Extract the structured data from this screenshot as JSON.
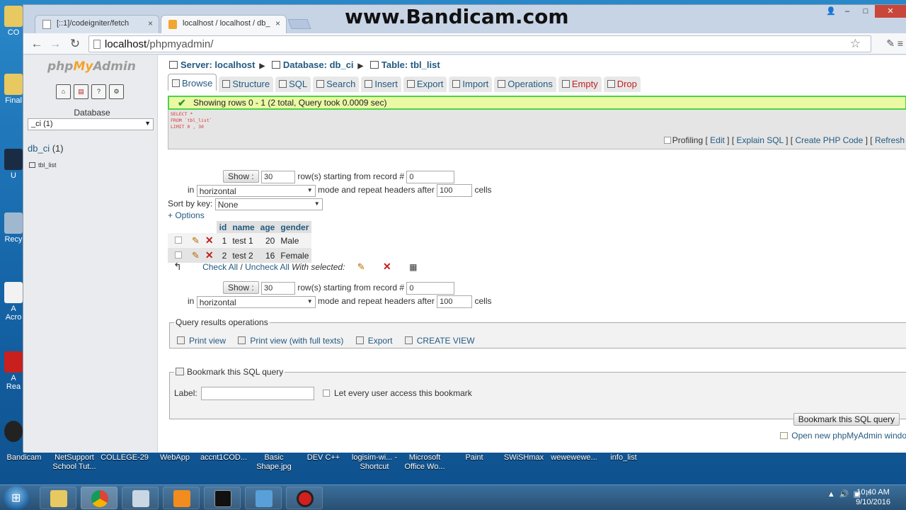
{
  "watermark": "www.Bandicam.com",
  "browser": {
    "tabs": [
      {
        "title": "[::1]/codeigniter/fetch",
        "close": "×"
      },
      {
        "title": "localhost / localhost / db_",
        "close": "×"
      }
    ],
    "url_host": "localhost",
    "url_path": "/phpmyadmin/",
    "nav": {
      "back": "←",
      "forward": "→",
      "reload": "↻",
      "star": "☆"
    },
    "window_controls": {
      "minimize": "–",
      "maximize": "□",
      "close": "✕"
    }
  },
  "sidebar": {
    "logo_php": "php",
    "logo_my": "My",
    "logo_admin": "Admin",
    "database_label": "Database",
    "db_select_value": "_ci (1)",
    "db_link": "db_ci",
    "db_count": " (1)",
    "table_item": "tbl_list",
    "icons": [
      "home-icon",
      "sql-icon",
      "docs-icon",
      "settings-icon"
    ]
  },
  "breadcrumb": {
    "server": "Server: localhost",
    "database": "Database: db_ci",
    "table": "Table: tbl_list",
    "sep": "▶"
  },
  "tabs": [
    "Browse",
    "Structure",
    "SQL",
    "Search",
    "Insert",
    "Export",
    "Import",
    "Operations",
    "Empty",
    "Drop"
  ],
  "message": "Showing rows 0 - 1 (2 total, Query took 0.0009 sec)",
  "sql": "SELECT *\nFROM `tbl_list`\nLIMIT 0 , 30",
  "sql_links": {
    "profiling": "Profiling",
    "edit": "Edit",
    "explain": "Explain SQL",
    "php": "Create PHP Code",
    "refresh": "Refresh"
  },
  "nav_controls": {
    "show_btn": "Show :",
    "rows_value": "30",
    "rows_label": "row(s) starting from record #",
    "start_value": "0",
    "in_label": "in",
    "mode_value": "horizontal",
    "mode_label": "mode and repeat headers after",
    "headers_value": "100",
    "cells_label": "cells",
    "sort_label": "Sort by key:",
    "sort_value": "None",
    "options": "+ Options"
  },
  "table": {
    "columns": [
      "id",
      "name",
      "age",
      "gender"
    ],
    "rows": [
      {
        "id": "1",
        "name": "test 1",
        "age": "20",
        "gender": "Male"
      },
      {
        "id": "2",
        "name": "test 2",
        "age": "16",
        "gender": "Female"
      }
    ]
  },
  "check_all": {
    "check": "Check All",
    "slash": " / ",
    "uncheck": "Uncheck All",
    "with_selected": "With selected:"
  },
  "query_ops": {
    "legend": "Query results operations",
    "print": "Print view",
    "print_full": "Print view (with full texts)",
    "export": "Export",
    "create_view": "CREATE VIEW"
  },
  "bookmark": {
    "legend": "Bookmark this SQL query",
    "label": "Label:",
    "share": "Let every user access this bookmark",
    "button": "Bookmark this SQL query"
  },
  "new_window": "Open new phpMyAdmin windo",
  "desktop": {
    "left_labels": [
      "CO",
      "Final",
      "U",
      "Recy",
      "A",
      "Acro",
      "A",
      "Rea"
    ],
    "labels": [
      "Bandicam",
      "NetSupport School Tut...",
      "COLLEGE-29",
      "WebApp",
      "accnt1COD...",
      "Basic Shape.jpg",
      "DEV C++",
      "logisim-wi... - Shortcut",
      "Microsoft Office Wo...",
      "Paint",
      "SWiSHmax",
      "wewewewe...",
      "info_list"
    ]
  },
  "taskbar": {
    "time": "10:40 AM",
    "date": "9/10/2016"
  }
}
